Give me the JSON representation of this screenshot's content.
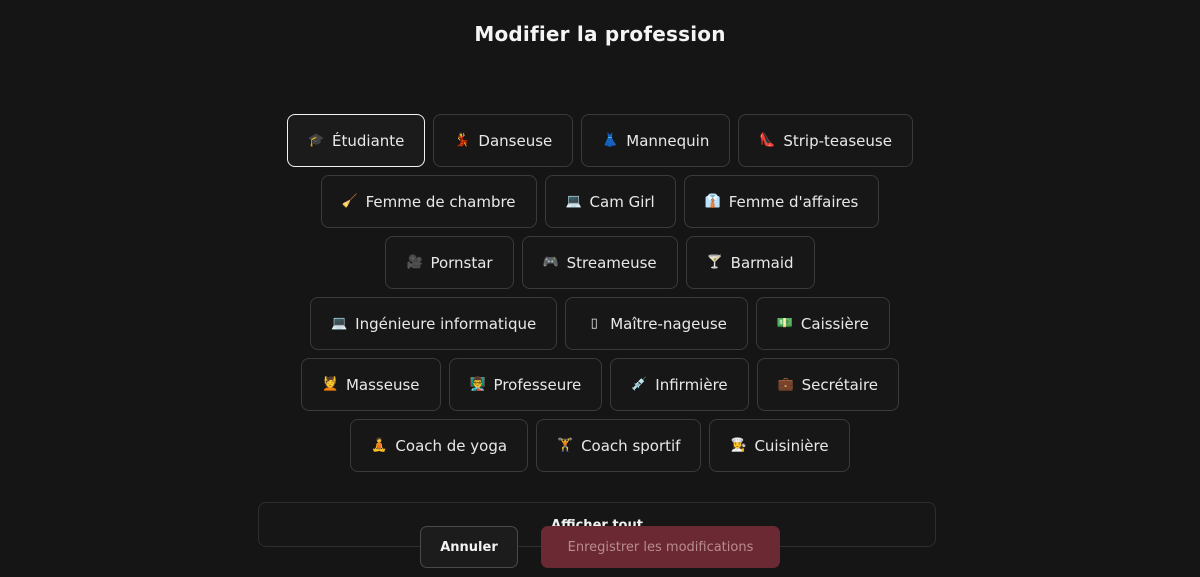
{
  "modal": {
    "title": "Modifier la profession",
    "show_all_label": "Afficher tout",
    "cancel_label": "Annuler",
    "save_label": "Enregistrer les modifications"
  },
  "professions": [
    {
      "emoji": "🎓",
      "label": "Étudiante",
      "selected": true
    },
    {
      "emoji": "💃",
      "label": "Danseuse"
    },
    {
      "emoji": "👗",
      "label": "Mannequin"
    },
    {
      "emoji": "👠",
      "label": "Strip-teaseuse"
    },
    {
      "emoji": "🧹",
      "label": "Femme de chambre"
    },
    {
      "emoji": "💻",
      "label": "Cam Girl"
    },
    {
      "emoji": "👔",
      "label": "Femme d'affaires"
    },
    {
      "emoji": "🎥",
      "label": "Pornstar"
    },
    {
      "emoji": "🎮",
      "label": "Streameuse"
    },
    {
      "emoji": "🍸",
      "label": "Barmaid"
    },
    {
      "emoji": "💻",
      "label": "Ingénieure informatique"
    },
    {
      "emoji": "▯",
      "label": "Maître-nageuse"
    },
    {
      "emoji": "💵",
      "label": "Caissière"
    },
    {
      "emoji": "💆",
      "label": "Masseuse"
    },
    {
      "emoji": "👨‍🏫",
      "label": "Professeure"
    },
    {
      "emoji": "💉",
      "label": "Infirmière"
    },
    {
      "emoji": "💼",
      "label": "Secrétaire"
    },
    {
      "emoji": "🧘",
      "label": "Coach de yoga"
    },
    {
      "emoji": "🏋",
      "label": "Coach sportif"
    },
    {
      "emoji": "👩‍🍳",
      "label": "Cuisinière"
    }
  ],
  "colors": {
    "background": "#151515",
    "chip_border": "#3a3a3a",
    "selected_border": "#f2f2f2",
    "save_button": "#6b2a33"
  }
}
